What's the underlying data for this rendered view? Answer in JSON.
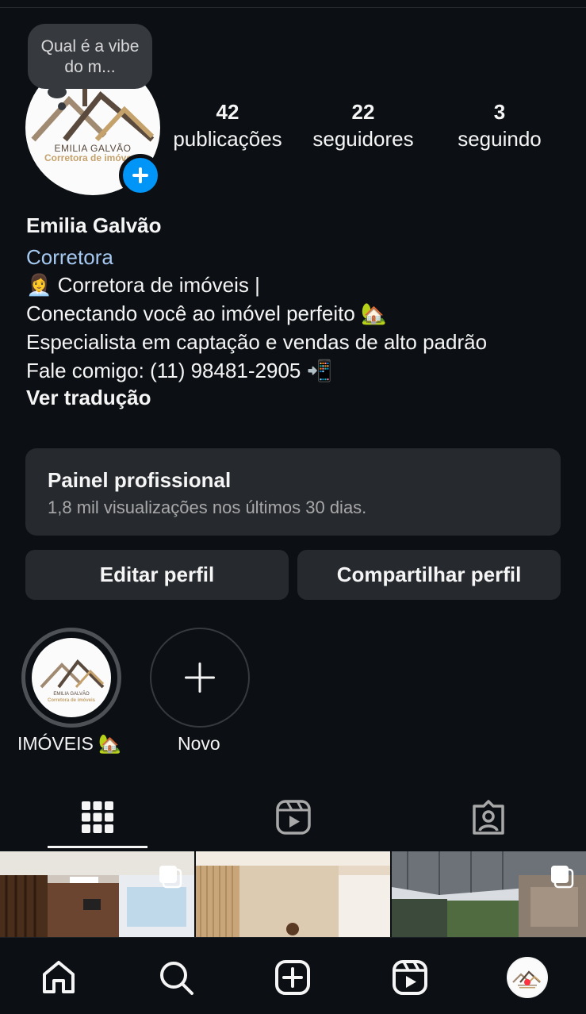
{
  "profile": {
    "note_bubble": "Qual é a vibe do m...",
    "logo_line1": "EMILIA GALVÃO",
    "logo_line2": "Corretora de imóve",
    "stats": [
      {
        "num": "42",
        "label": "publicações"
      },
      {
        "num": "22",
        "label": "seguidores"
      },
      {
        "num": "3",
        "label": "seguindo"
      }
    ],
    "name": "Emilia Galvão",
    "category": "Corretora",
    "bio": [
      "👩‍💼 Corretora de imóveis |",
      "Conectando você ao imóvel perfeito 🏡",
      "Especialista em captação e vendas de alto padrão",
      "Fale comigo: (11) 98481-2905 📲"
    ],
    "translate_link": "Ver tradução"
  },
  "panel": {
    "title": "Painel profissional",
    "subtitle": "1,8 mil visualizações nos últimos 30 dias."
  },
  "buttons": {
    "edit": "Editar perfil",
    "share": "Compartilhar perfil"
  },
  "highlights": [
    {
      "label": "IMÓVEIS 🏡",
      "logo_line1": "EMILIA GALVÃO",
      "logo_line2": "Corretora de imóveis"
    },
    {
      "label": "Novo"
    }
  ],
  "tabs": [
    {
      "icon": "grid-icon",
      "active": true
    },
    {
      "icon": "reels-icon",
      "active": false
    },
    {
      "icon": "tagged-icon",
      "active": false
    }
  ],
  "nav": [
    "home-icon",
    "search-icon",
    "create-icon",
    "reels-icon",
    "profile-avatar"
  ],
  "colors": {
    "background": "#0c1014",
    "accent": "#0095f6",
    "link": "#a6c9f2",
    "surface": "#262a2f",
    "notification": "#ff3040"
  }
}
